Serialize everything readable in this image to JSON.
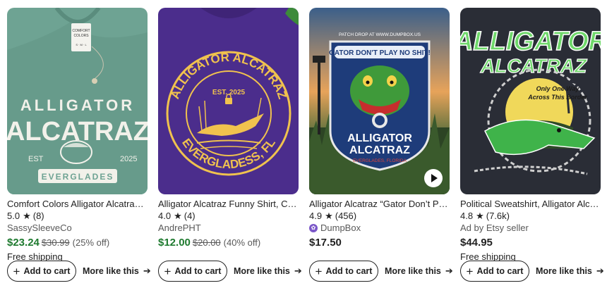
{
  "listings": [
    {
      "title": "Comfort Colors Alligator Alcatraz Shi…",
      "rating": "5.0",
      "reviews": "(8)",
      "shop": "SassySleeveCo",
      "shop_badge": false,
      "price": "$23.24",
      "original_price": "$30.99",
      "discount": "(25% off)",
      "shipping": "Free shipping",
      "add_label": "Add to cart",
      "more_label": "More like this",
      "image": {
        "bg_color": "#6ea393",
        "print_color": "#f2f1ea",
        "lines": [
          "ALLIGATOR",
          "ALCATRAZ"
        ],
        "sub_left": "EST",
        "sub_right": "2025",
        "banner": "EVERGLADES",
        "tag_lines": [
          "COMFORT",
          "COLORS"
        ],
        "tag_size": "S · M · L"
      }
    },
    {
      "title": "Alligator Alcatraz Funny Shirt, Custo…",
      "rating": "4.0",
      "reviews": "(4)",
      "shop": "AndrePHT",
      "shop_badge": false,
      "price": "$12.00",
      "original_price": "$20.00",
      "discount": "(40% off)",
      "shipping": "",
      "add_label": "Add to cart",
      "more_label": "More like this",
      "image": {
        "bg_color": "#4b2d8c",
        "print_color": "#f0c24e",
        "top_text": "ALLIGATOR ALCATRAZ",
        "est": "EST. 2025",
        "bottom_text": "EVERGLADESS, FL"
      }
    },
    {
      "title": "Alligator Alcatraz “Gator Don’t Play N…",
      "rating": "4.9",
      "reviews": "(456)",
      "shop": "DumpBox",
      "shop_badge": true,
      "price": "$17.50",
      "original_price": "",
      "discount": "",
      "shipping": "",
      "add_label": "Add to cart",
      "more_label": "More like this",
      "image": {
        "header": "PATCH DROP AT WWW.DUMPBOX.US",
        "patch_top": "GATOR DON'T PLAY NO SHIT!",
        "patch_lines": [
          "ALLIGATOR",
          "ALCATRAZ"
        ],
        "patch_bottom": "EVERGLADES, FLORIDA"
      }
    },
    {
      "title": "Political Sweatshirt, Alligator Alcatra…",
      "rating": "4.8",
      "reviews": "(7.6k)",
      "shop": "Ad by Etsy seller",
      "shop_badge": false,
      "price": "$44.95",
      "original_price": "",
      "discount": "",
      "shipping": "Free shipping",
      "add_label": "Add to cart",
      "more_label": "More like this",
      "image": {
        "bg_color": "#2a2d36",
        "lines": [
          "ALLIGATOR",
          "ALCATRAZ"
        ],
        "tagline_1": "Only One Way",
        "tagline_2": "Across This Border"
      }
    }
  ]
}
